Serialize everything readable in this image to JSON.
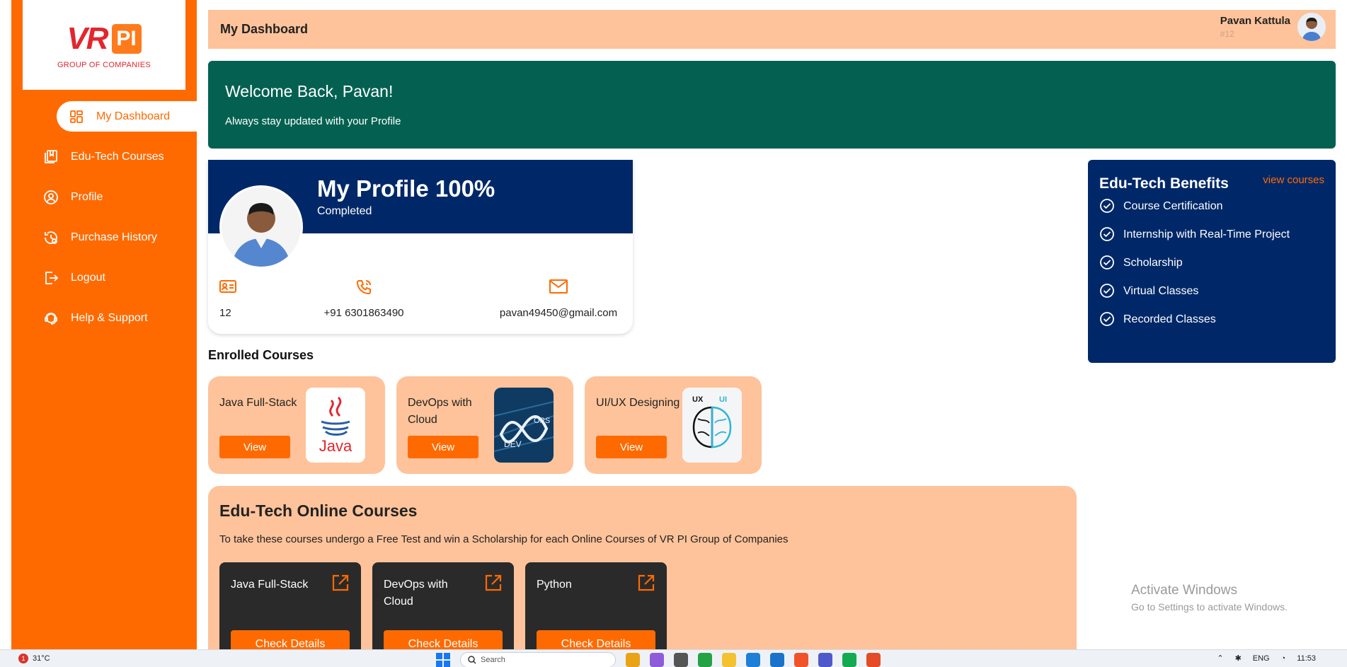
{
  "sidebar": {
    "logo": {
      "brand_a": "VR",
      "brand_b": "PI",
      "subtitle": "GROUP OF COMPANIES"
    },
    "items": [
      {
        "label": "My Dashboard",
        "icon": "dashboard-icon",
        "active": true
      },
      {
        "label": "Edu-Tech Courses",
        "icon": "book-icon"
      },
      {
        "label": "Profile",
        "icon": "user-circle-icon"
      },
      {
        "label": "Purchase History",
        "icon": "history-icon"
      },
      {
        "label": "Logout",
        "icon": "logout-icon"
      },
      {
        "label": "Help & Support",
        "icon": "support-icon"
      }
    ]
  },
  "header": {
    "title": "My Dashboard",
    "user_name": "Pavan Kattula",
    "user_id": "#12"
  },
  "welcome": {
    "title": "Welcome Back, Pavan!",
    "subtitle": "Always stay updated with your Profile"
  },
  "profile": {
    "title": "My Profile 100%",
    "status": "Completed",
    "id_value": "12",
    "phone": "+91 6301863490",
    "email": "pavan49450@gmail.com"
  },
  "enrolled": {
    "title": "Enrolled Courses",
    "courses": [
      {
        "name": "Java Full-Stack",
        "button": "View",
        "thumb": "java-logo"
      },
      {
        "name": "DevOps with Cloud",
        "button": "View",
        "thumb": "devops-logo"
      },
      {
        "name": "UI/UX Designing",
        "button": "View",
        "thumb": "uiux-brain-logo"
      }
    ]
  },
  "online": {
    "title": "Edu-Tech Online Courses",
    "subtitle": "To take these courses undergo a Free Test and win a Scholarship for each Online Courses of VR PI Group of Companies",
    "courses": [
      {
        "name": "Java Full-Stack",
        "button": "Check Details"
      },
      {
        "name": "DevOps with Cloud",
        "button": "Check Details"
      },
      {
        "name": "Python",
        "button": "Check Details"
      }
    ]
  },
  "benefits": {
    "title": "Edu-Tech Benefits",
    "link": "view courses",
    "items": [
      "Course Certification",
      "Internship with Real-Time Project",
      "Scholarship",
      "Virtual Classes",
      "Recorded Classes"
    ]
  },
  "watermark": {
    "line1": "Activate Windows",
    "line2": "Go to Settings to activate Windows."
  },
  "taskbar": {
    "temp": "31°C",
    "badge": "1",
    "search": "Search",
    "lang": "ENG",
    "time": "11:53"
  },
  "colors": {
    "accent": "#ff6a00",
    "navy": "#002868",
    "teal": "#046152",
    "peach": "#fec39a"
  }
}
